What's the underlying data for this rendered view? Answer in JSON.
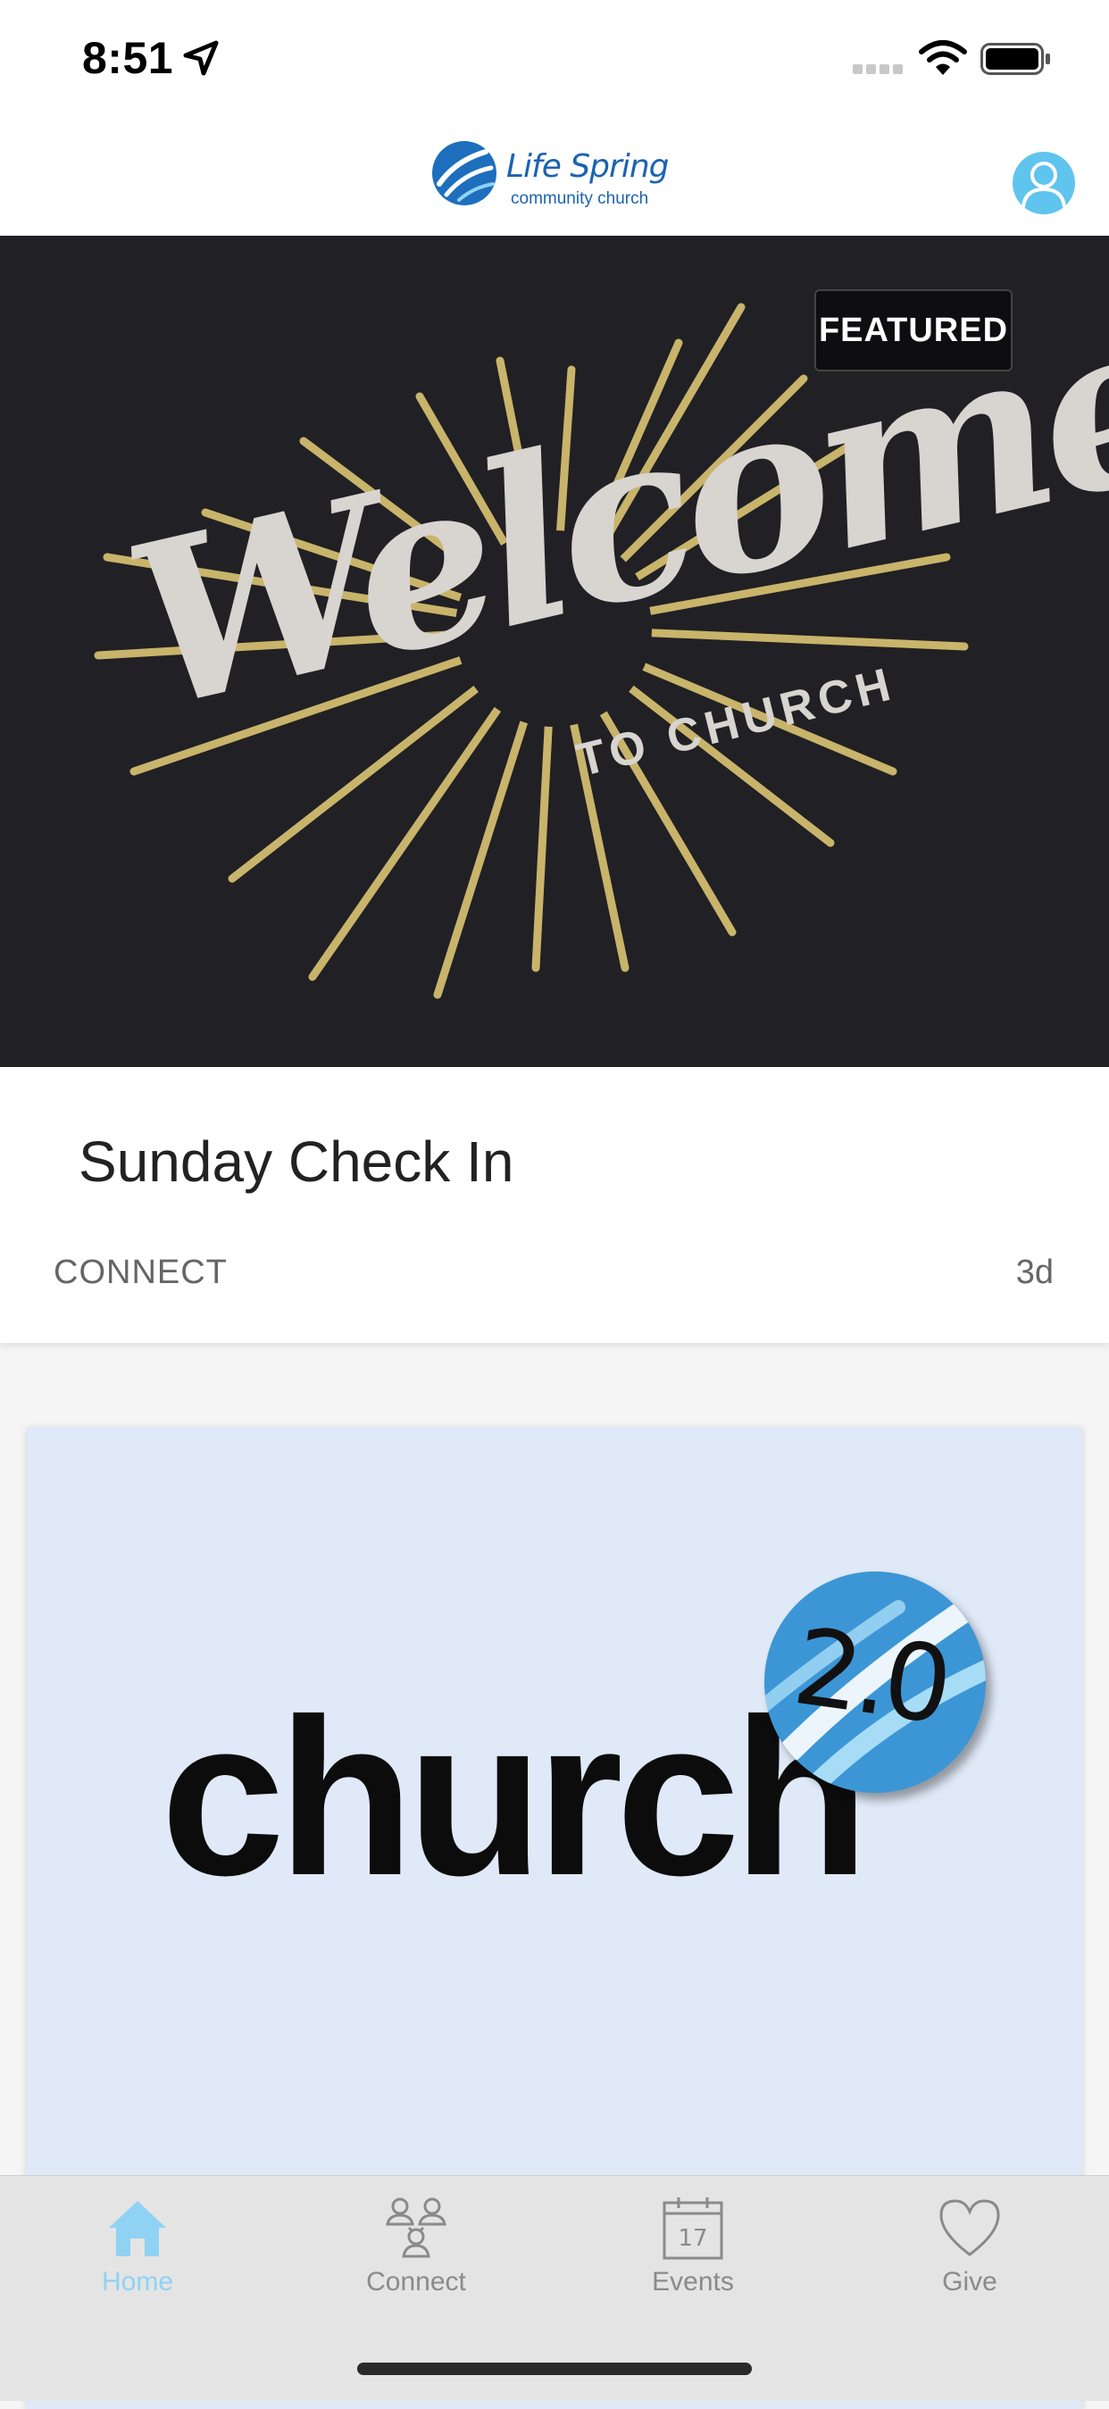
{
  "status_bar": {
    "time": "8:51"
  },
  "header": {
    "logo_name": "Life Spring",
    "logo_subtitle": "community church",
    "profile_icon": "user-icon"
  },
  "featured_card": {
    "badge": "FEATURED",
    "image_headline": "Welcome",
    "image_subline": "TO CHURCH",
    "title": "Sunday Check In",
    "category": "CONNECT",
    "age": "3d"
  },
  "second_card": {
    "image_word": "church",
    "image_badge": "2.0"
  },
  "tab_bar": {
    "active": "Home",
    "accent": "#8fd2f4",
    "items": [
      {
        "label": "Home",
        "icon": "home-icon"
      },
      {
        "label": "Connect",
        "icon": "people-icon"
      },
      {
        "label": "Events",
        "icon": "calendar-icon",
        "icon_text": "17"
      },
      {
        "label": "Give",
        "icon": "heart-icon"
      }
    ]
  }
}
